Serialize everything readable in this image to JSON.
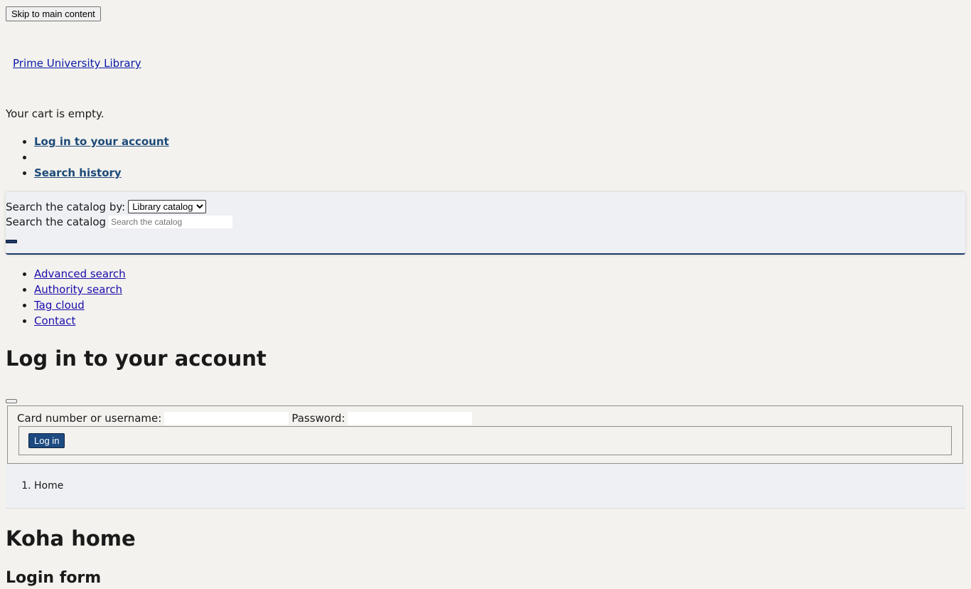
{
  "skip_link": {
    "label": "Skip to main content"
  },
  "header": {
    "logo_text": "Prime University Library",
    "cart_text": "Your cart is empty."
  },
  "user_menu": {
    "items": [
      {
        "label": "Log in to your account"
      },
      {
        "label": ""
      },
      {
        "label": "Search history"
      }
    ]
  },
  "search": {
    "by_label": "Search the catalog by:",
    "selected_option": "Library catalog",
    "input_label": "Search the catalog",
    "placeholder": "Search the catalog"
  },
  "more_nav": {
    "items": [
      {
        "label": "Advanced search"
      },
      {
        "label": "Authority search"
      },
      {
        "label": "Tag cloud"
      },
      {
        "label": "Contact"
      }
    ]
  },
  "login": {
    "title": "Log in to your account",
    "username_label": "Card number or username:",
    "password_label": "Password:",
    "submit_label": "Log in"
  },
  "breadcrumb": {
    "items": [
      {
        "label": "Home"
      }
    ]
  },
  "main": {
    "title": "Koha home",
    "subtitle": "Login form"
  },
  "colors": {
    "page_bg": "#f3f2ee",
    "search_bar_bg": "#eef0f4",
    "accent_navy": "#1d3a6a",
    "link_blue": "#1a0dab",
    "user_link": "#1d4a78"
  }
}
